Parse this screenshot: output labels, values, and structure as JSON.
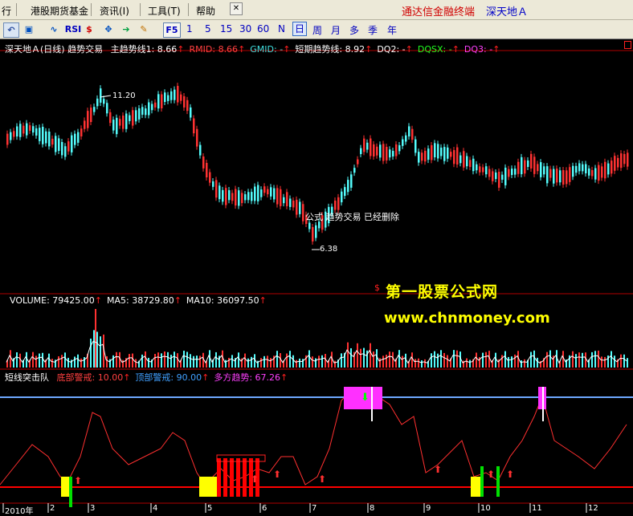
{
  "menubar": {
    "items": [
      "行",
      "港股期货基金",
      "资讯(I)",
      "工具(T)",
      "帮助"
    ],
    "brand": "通达信金融终端",
    "stock": "深天地Ａ"
  },
  "toolbar": {
    "icons": [
      "RSI",
      "$"
    ],
    "fx": "F5",
    "periods": [
      "1",
      "5",
      "15",
      "30",
      "60",
      "N",
      "日",
      "周",
      "月",
      "多",
      "季",
      "年"
    ],
    "active_period": "日"
  },
  "main_header": {
    "stock": "深天地Ａ",
    "period": "(日线)",
    "formula": "趋势交易",
    "items": [
      {
        "label": "主趋势线1:",
        "value": "8.66",
        "color": "#ffffff"
      },
      {
        "label": "RMID:",
        "value": "8.66",
        "color": "#ff4040"
      },
      {
        "label": "GMID:",
        "value": "-",
        "color": "#40e0e0"
      },
      {
        "label": "短期趋势线:",
        "value": "8.92",
        "color": "#ffffff"
      },
      {
        "label": "DQ2:",
        "value": "-",
        "color": "#ffffff"
      },
      {
        "label": "DQSX:",
        "value": "-",
        "color": "#20ff20"
      },
      {
        "label": "DQ3:",
        "value": "-",
        "color": "#ff40ff"
      }
    ]
  },
  "price_annotations": {
    "high": "11.20",
    "low": "6.38",
    "note": "公式 趋势交易 已经删除"
  },
  "watermark": {
    "line1": "第一股票公式网",
    "line2": "www.chnmoney.com"
  },
  "volume_header": [
    {
      "label": "VOLUME:",
      "value": "79425.00",
      "color": "#ffffff"
    },
    {
      "label": "MA5:",
      "value": "38729.80",
      "color": "#ffffff"
    },
    {
      "label": "MA10:",
      "value": "36097.50",
      "color": "#ffffff"
    }
  ],
  "indicator_header": {
    "name": "短线突击队",
    "items": [
      {
        "label": "底部警戒:",
        "value": "10.00",
        "color": "#ff4040"
      },
      {
        "label": "顶部警戒:",
        "value": "90.00",
        "color": "#40a0ff"
      },
      {
        "label": "多方趋势:",
        "value": "67.26",
        "color": "#ff40ff"
      }
    ]
  },
  "x_axis": {
    "labels": [
      "2010年",
      "2",
      "3",
      "4",
      "5",
      "6",
      "7",
      "8",
      "9",
      "10",
      "11",
      "12"
    ]
  },
  "colors": {
    "up": "#ff3232",
    "down": "#54fcfc",
    "grid": "#b00000",
    "ma": "#ffffff",
    "bottom_line": "#ff0000",
    "top_line": "#6ea8ff",
    "trend": "#ff3030"
  }
}
